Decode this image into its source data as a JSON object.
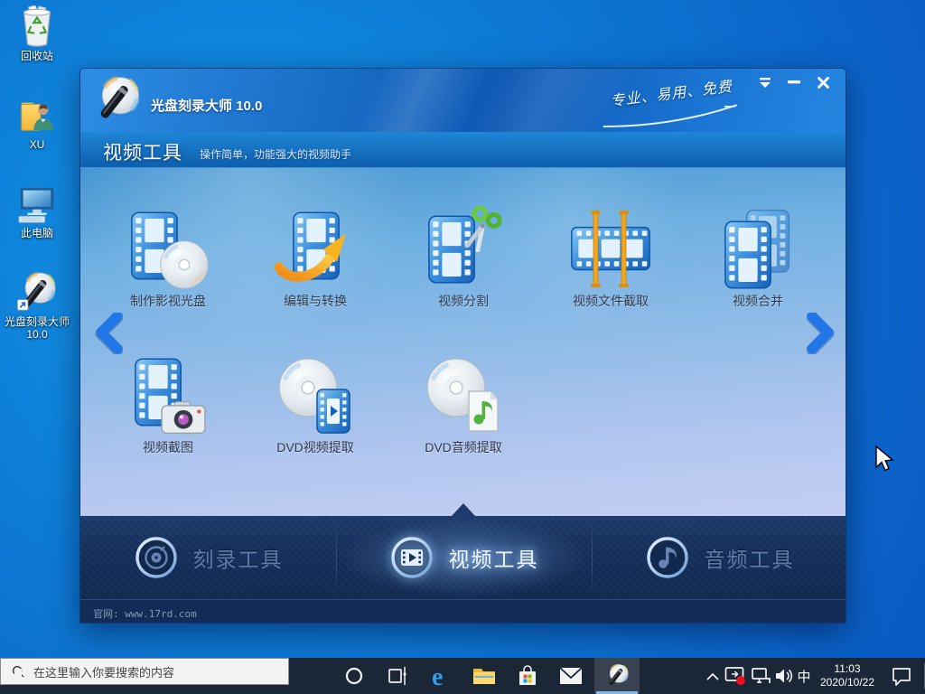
{
  "colors": {
    "desktop_blue": "#0d7ad4",
    "titlebar_blue": "#1a74d2",
    "tabbar_navy": "#16315d",
    "taskbar_dark": "#1b2636",
    "active_underline": "#86b9e6",
    "tool_label": "#2e3a4d"
  },
  "desktop": {
    "icons": [
      {
        "name": "recycle-bin",
        "label": "回收站"
      },
      {
        "name": "user-folder",
        "label": "XU"
      },
      {
        "name": "this-pc",
        "label": "此电脑"
      },
      {
        "name": "app-shortcut",
        "label": "光盘刻录大师 10.0"
      }
    ]
  },
  "window": {
    "title": "光盘刻录大师 10.0",
    "slogan": "专业、易用、免费",
    "header": {
      "title": "视频工具",
      "subtitle": "操作简单，功能强大的视频助手"
    },
    "tools": [
      {
        "label": "制作影视光盘",
        "icon": "film-with-disc"
      },
      {
        "label": "编辑与转换",
        "icon": "film-with-convert-arrow"
      },
      {
        "label": "视频分割",
        "icon": "film-with-scissors"
      },
      {
        "label": "视频文件截取",
        "icon": "film-with-clip-markers"
      },
      {
        "label": "视频合并",
        "icon": "double-film"
      },
      {
        "label": "视频截图",
        "icon": "film-with-camera"
      },
      {
        "label": "DVD视频提取",
        "icon": "disc-with-video"
      },
      {
        "label": "DVD音频提取",
        "icon": "disc-with-music-note"
      }
    ],
    "tabs": [
      {
        "label": "刻录工具",
        "icon": "burn-disc",
        "active": false
      },
      {
        "label": "视频工具",
        "icon": "video-film",
        "active": true
      },
      {
        "label": "音频工具",
        "icon": "audio-note",
        "active": false
      }
    ],
    "footer": "官网: www.17rd.com"
  },
  "taskbar": {
    "search_placeholder": "在这里输入你要搜索的内容",
    "edge_glyph": "e",
    "ime_indicator": "中",
    "clock": {
      "time": "11:03",
      "date": "2020/10/22"
    }
  }
}
